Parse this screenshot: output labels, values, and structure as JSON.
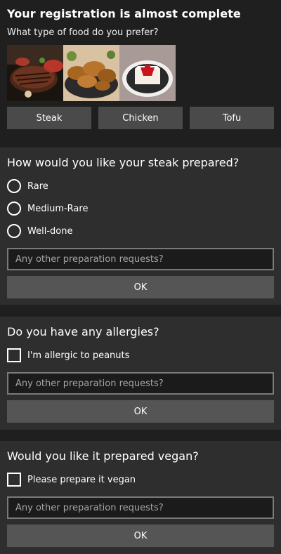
{
  "header": {
    "title": "Your registration is almost complete",
    "question": "What type of food do you prefer?"
  },
  "food_options": [
    {
      "label": "Steak",
      "image": "steak-photo"
    },
    {
      "label": "Chicken",
      "image": "chicken-photo"
    },
    {
      "label": "Tofu",
      "image": "tofu-photo"
    }
  ],
  "steak_section": {
    "title": "How would you like your steak prepared?",
    "options": [
      "Rare",
      "Medium-Rare",
      "Well-done"
    ],
    "input_placeholder": "Any other preparation requests?",
    "ok_label": "OK"
  },
  "allergy_section": {
    "title": "Do you have any allergies?",
    "checkbox_label": "I'm allergic to peanuts",
    "input_placeholder": "Any other preparation requests?",
    "ok_label": "OK"
  },
  "vegan_section": {
    "title": "Would you like it prepared vegan?",
    "checkbox_label": "Please prepare it vegan",
    "input_placeholder": "Any other preparation requests?",
    "ok_label": "OK"
  }
}
